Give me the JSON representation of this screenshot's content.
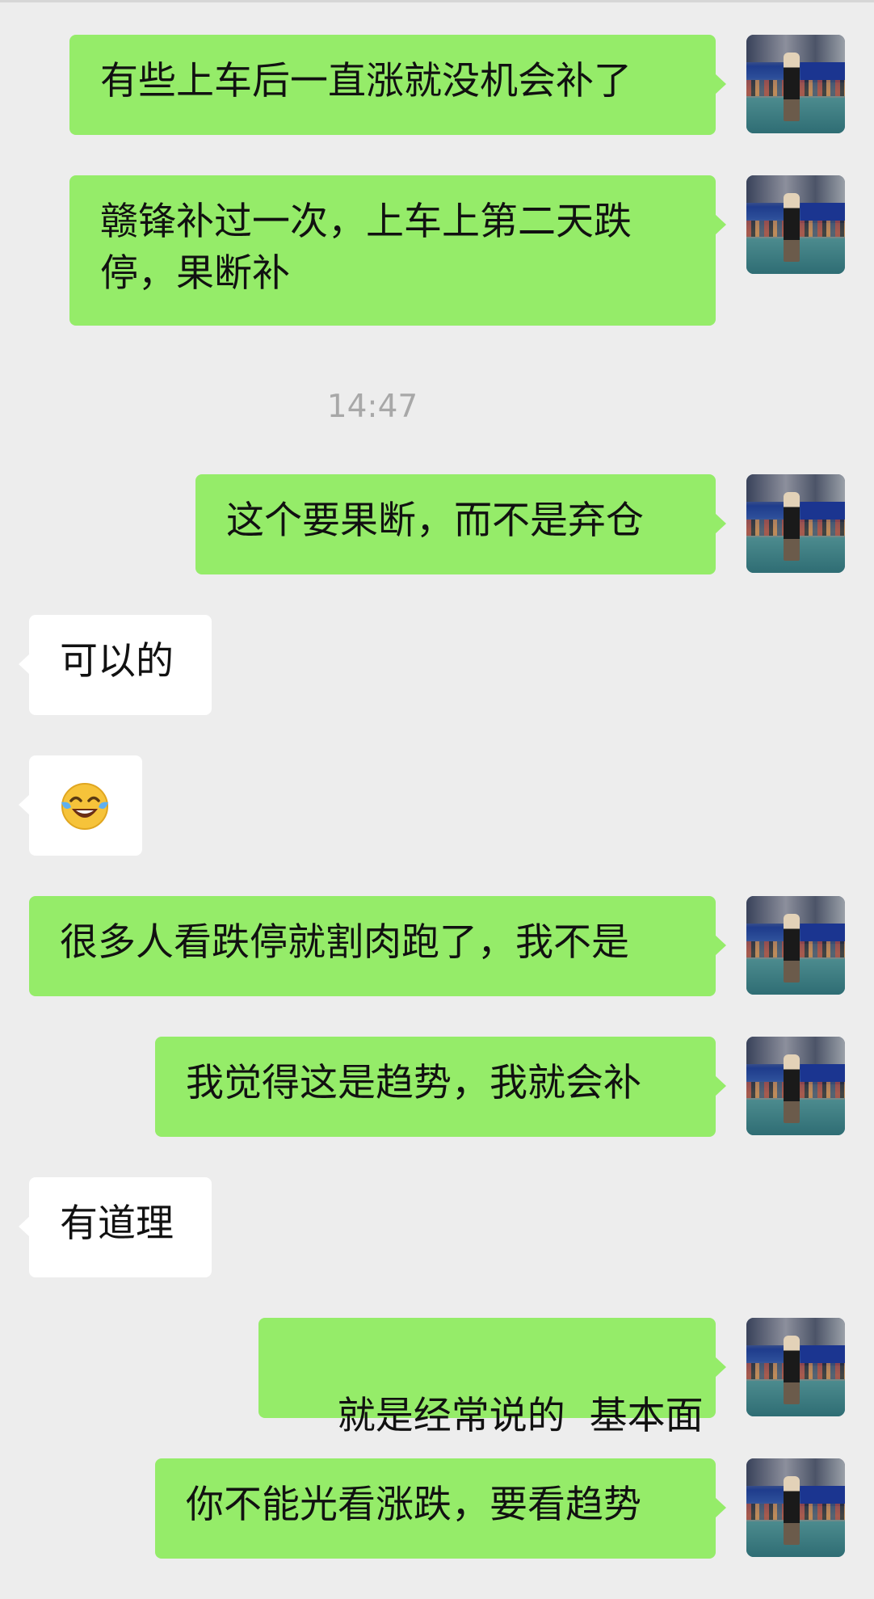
{
  "conversation": {
    "timestamp": "14:47",
    "messages": [
      {
        "side": "me",
        "text": "有些上车后一直涨就没机会补了"
      },
      {
        "side": "me",
        "text": "赣锋补过一次，上车上第二天跌停，果断补"
      },
      {
        "side": "me",
        "text": "这个要果断，而不是弃仓"
      },
      {
        "side": "other",
        "text": "可以的"
      },
      {
        "side": "other",
        "emoji": "face-with-tears-of-joy"
      },
      {
        "side": "me",
        "text": "很多人看跌停就割肉跑了，我不是"
      },
      {
        "side": "me",
        "text": "我觉得这是趋势，我就会补"
      },
      {
        "side": "other",
        "text": "有道理"
      },
      {
        "side": "me",
        "text": "就是经常说的  基本面"
      },
      {
        "side": "me",
        "text": "你不能光看涨跌，要看趋势"
      }
    ]
  },
  "colors": {
    "background": "#ededed",
    "my_bubble": "#95ec69",
    "other_bubble": "#ffffff",
    "timestamp_text": "#a8a8a8"
  }
}
